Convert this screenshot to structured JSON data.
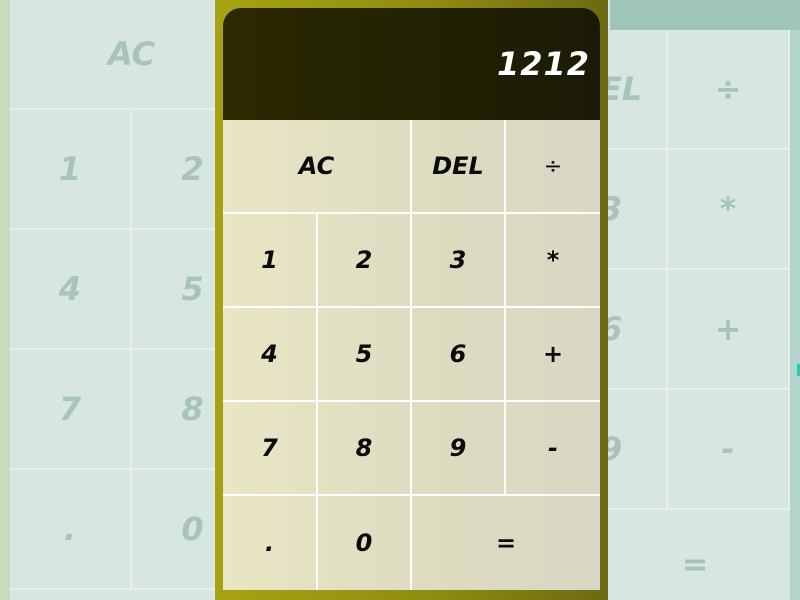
{
  "display": {
    "value": "1212"
  },
  "keypad": {
    "ac": "AC",
    "del": "DEL",
    "divide": "÷",
    "multiply": "*",
    "add": "+",
    "subtract": "-",
    "equals": "=",
    "dot": ".",
    "digits": [
      "0",
      "1",
      "2",
      "3",
      "4",
      "5",
      "6",
      "7",
      "8",
      "9"
    ]
  },
  "background_calculator": {
    "labels": [
      "AC",
      "EL",
      "÷",
      "1",
      "2",
      "3",
      "*",
      "4",
      "5",
      "6",
      "+",
      "7",
      "8",
      "9",
      "-",
      ".",
      "0",
      "="
    ]
  },
  "colors": {
    "frame": "#a7a313",
    "display_bg": "#1f1e04",
    "keys_bg": "#e4e2c4",
    "page_bg": "#c4d8c4"
  }
}
